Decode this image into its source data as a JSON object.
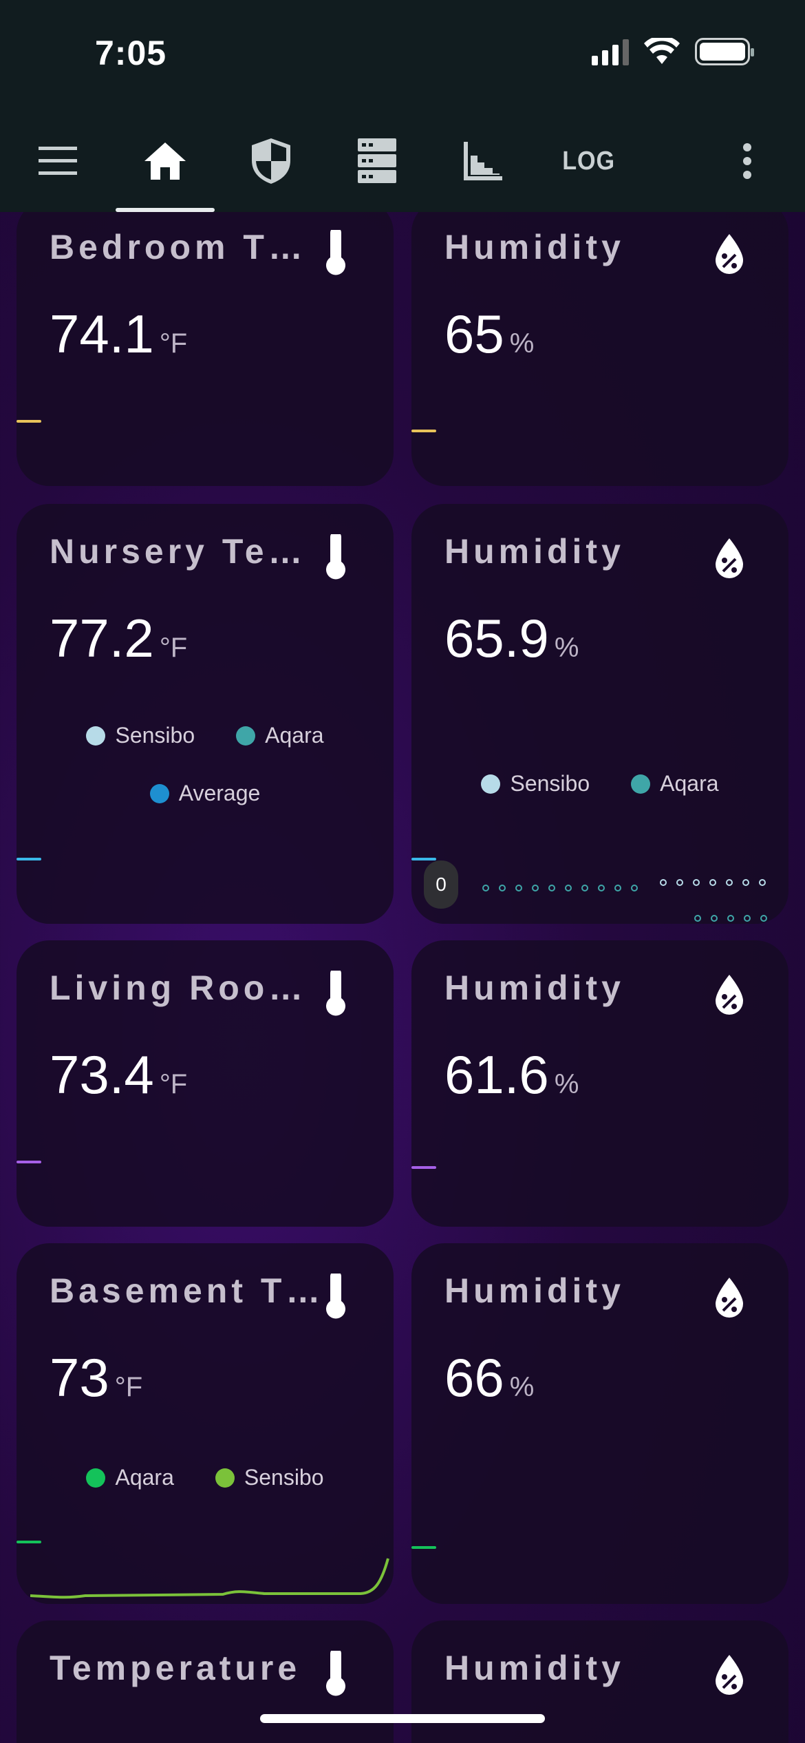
{
  "status_bar": {
    "time": "7:05"
  },
  "nav": {
    "log_label": "LOG"
  },
  "cards": [
    {
      "title": "Bedroom T…",
      "value": "74.1",
      "unit": "°F",
      "icon": "thermometer-icon",
      "tick_color": "#e8c35a"
    },
    {
      "title": "Humidity",
      "value": "65",
      "unit": "%",
      "icon": "water-percent-icon",
      "tick_color": "#e8c35a"
    },
    {
      "title": "Nursery Te…",
      "value": "77.2",
      "unit": "°F",
      "icon": "thermometer-icon",
      "tick_color": "#3ab8e8",
      "legend": [
        {
          "label": "Sensibo",
          "color": "#b7dbe8"
        },
        {
          "label": "Aqara",
          "color": "#3fa6a8"
        },
        {
          "label": "Average",
          "color": "#1e8fd0"
        }
      ]
    },
    {
      "title": "Humidity",
      "value": "65.9",
      "unit": "%",
      "icon": "water-percent-icon",
      "tick_color": "#3ab8e8",
      "legend": [
        {
          "label": "Sensibo",
          "color": "#b7dbe8"
        },
        {
          "label": "Aqara",
          "color": "#3fa6a8"
        }
      ],
      "badge": "0"
    },
    {
      "title": "Living Roo…",
      "value": "73.4",
      "unit": "°F",
      "icon": "thermometer-icon",
      "tick_color": "#a660e8"
    },
    {
      "title": "Humidity",
      "value": "61.6",
      "unit": "%",
      "icon": "water-percent-icon",
      "tick_color": "#a660e8"
    },
    {
      "title": "Basement T…",
      "value": "73",
      "unit": "°F",
      "icon": "thermometer-icon",
      "tick_color": "#14c25a",
      "legend": [
        {
          "label": "Aqara",
          "color": "#14c25a"
        },
        {
          "label": "Sensibo",
          "color": "#7bc23a"
        }
      ]
    },
    {
      "title": "Humidity",
      "value": "66",
      "unit": "%",
      "icon": "water-percent-icon",
      "tick_color": "#14c25a"
    },
    {
      "title": "Temperature",
      "value": "",
      "unit": "",
      "icon": "thermometer-icon"
    },
    {
      "title": "Humidity",
      "value": "",
      "unit": "",
      "icon": "water-percent-icon"
    }
  ]
}
